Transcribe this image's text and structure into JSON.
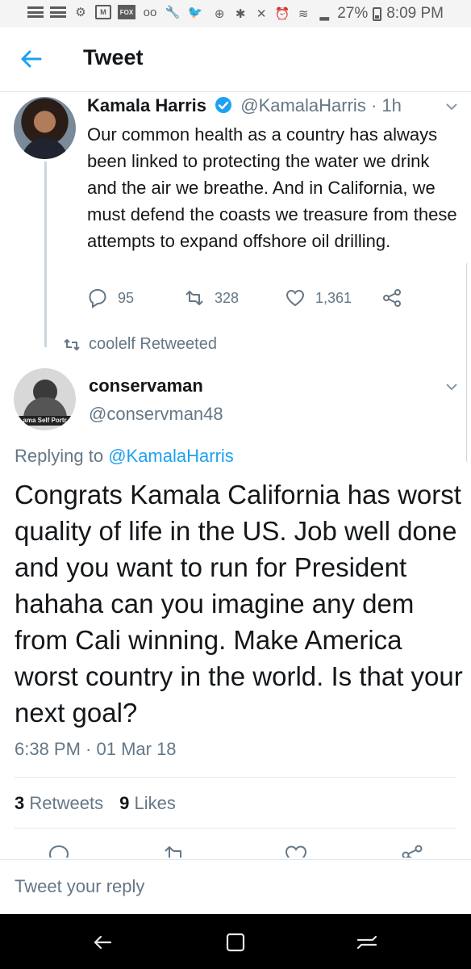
{
  "status_bar": {
    "battery": "27%",
    "time": "8:09 PM",
    "notification_icons": [
      "menu-lines-icon",
      "menu-lines-icon",
      "settings-icon",
      "gmail-icon",
      "fox-news-icon",
      "voicemail-icon",
      "wrench-icon",
      "twitter-icon"
    ],
    "fox_label": "FOX"
  },
  "header": {
    "title": "Tweet"
  },
  "parent_tweet": {
    "name": "Kamala Harris",
    "handle": "@KamalaHarris",
    "age": "· 1h",
    "text": "Our common health as a country has always been linked to protecting the water we drink and the air we breathe. And in California, we must defend the coasts we treasure from these attempts to expand offshore oil drilling.",
    "replies": "95",
    "retweets": "328",
    "likes": "1,361"
  },
  "retweeted_by": "coolelf Retweeted",
  "main_tweet": {
    "name": "conservaman",
    "handle": "@conservman48",
    "avatar_caption": "ama Self Portr",
    "replying_prefix": "Replying to ",
    "replying_to": "@KamalaHarris",
    "text": "Congrats Kamala California has worst quality of life in the US. Job well done and you want to run for President hahaha can you imagine any dem from Cali winning. Make America worst country in the world. Is that your next goal?",
    "timestamp": "6:38 PM · 01 Mar 18",
    "retweet_count": "3",
    "retweet_label": "Retweets",
    "like_count": "9",
    "like_label": "Likes"
  },
  "reply_bar": {
    "placeholder": "Tweet your reply"
  },
  "colors": {
    "accent": "#1da1f2",
    "secondary_text": "#657786",
    "primary_text": "#14171a"
  }
}
